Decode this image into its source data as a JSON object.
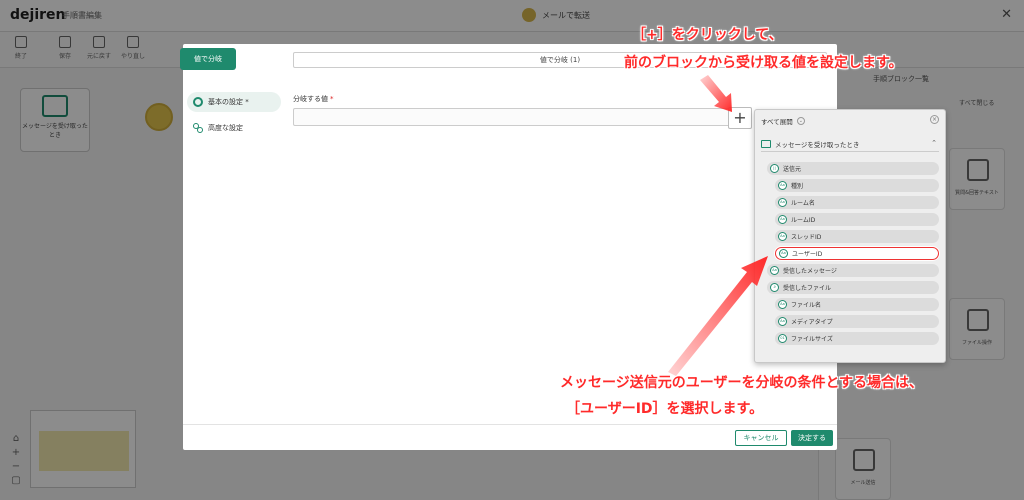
{
  "app": {
    "logo": "dejiren",
    "subtitle": "手順書編集",
    "center_title": "メールで転送",
    "toolbar": [
      "終了",
      "保存",
      "元に戻す",
      "やり直し"
    ],
    "canvas_node_label": "メッセージを受け取ったとき",
    "right_panel": {
      "title": "手順ブロック一覧",
      "expand_all": "すべて閉じる",
      "cards": [
        "質問&回答テキスト",
        "ファイル操作",
        "メール送信"
      ]
    }
  },
  "modal": {
    "tab_label": "値で分岐",
    "title": "値で分岐 (1)",
    "sidebar": [
      {
        "label": "基本の設定 *",
        "icon": "gear-icon"
      },
      {
        "label": "高度な設定",
        "icon": "nodes-icon"
      }
    ],
    "field_label": "分岐する値",
    "field_required": "*",
    "plus": "+",
    "cancel_label": "キャンセル",
    "ok_label": "決定する"
  },
  "picker": {
    "expand_all": "すべて展開",
    "section": "メッセージを受け取ったとき",
    "items": [
      {
        "label": "送信元",
        "level": 0,
        "icon": "group-icon"
      },
      {
        "label": "種別",
        "level": 1,
        "icon": "text-icon"
      },
      {
        "label": "ルーム名",
        "level": 1,
        "icon": "text-icon"
      },
      {
        "label": "ルームID",
        "level": 1,
        "icon": "text-icon"
      },
      {
        "label": "スレッドID",
        "level": 1,
        "icon": "text-icon"
      },
      {
        "label": "ユーザーID",
        "level": 1,
        "icon": "text-icon",
        "selected": true
      },
      {
        "label": "受信したメッセージ",
        "level": 0,
        "icon": "text-icon"
      },
      {
        "label": "受信したファイル",
        "level": 0,
        "icon": "clip-icon"
      },
      {
        "label": "ファイル名",
        "level": 1,
        "icon": "text-icon"
      },
      {
        "label": "メディアタイプ",
        "level": 1,
        "icon": "text-icon"
      },
      {
        "label": "ファイルサイズ",
        "level": 1,
        "icon": "number-icon"
      }
    ]
  },
  "annotations": {
    "top_line1": "［+］をクリックして、",
    "top_line2": "前のブロックから受け取る値を設定します。",
    "bottom_line1": "メッセージ送信元のユーザーを分岐の条件とする場合は、",
    "bottom_line2": "［ユーザーID］を選択します。"
  },
  "colors": {
    "accent": "#1f8a6d",
    "annotation": "#ff2a2a",
    "overlay": "rgba(0,0,0,0.45)"
  }
}
